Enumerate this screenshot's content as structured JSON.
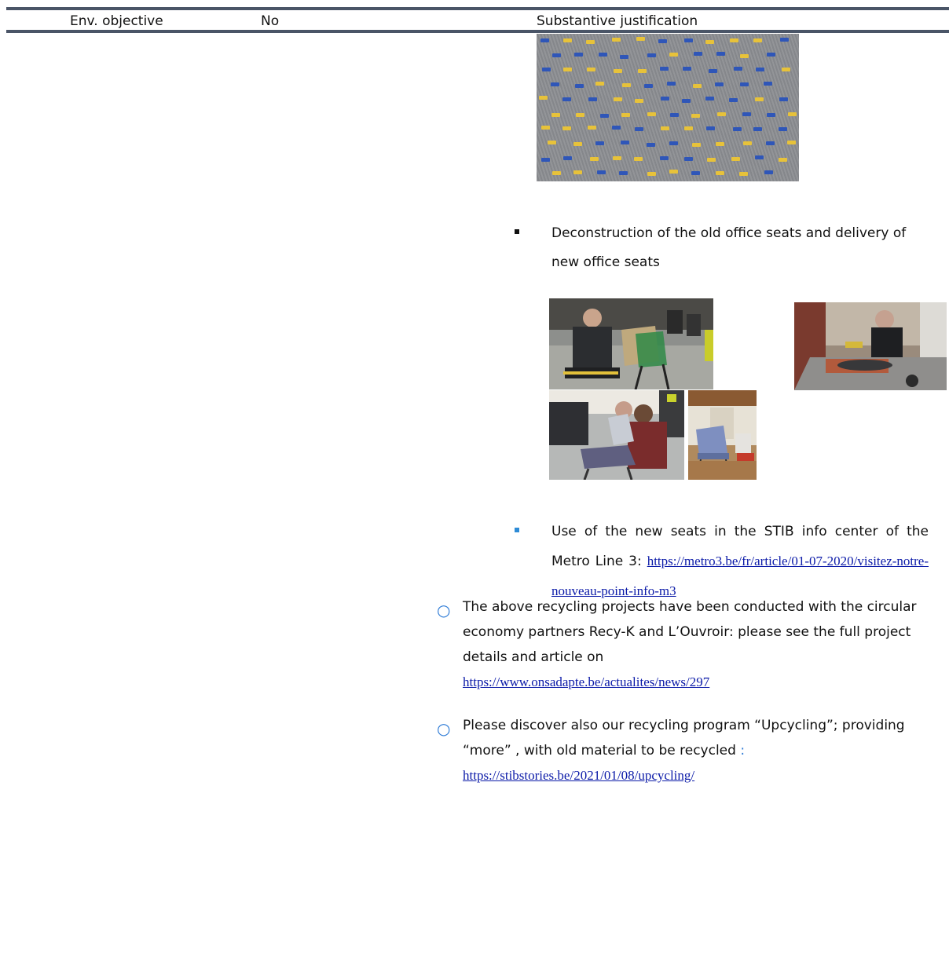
{
  "table_header": {
    "col1": "Env. objective",
    "col2": "No",
    "col3": "Substantive justification"
  },
  "items": {
    "deconstruction": "Deconstruction of the old office seats and delivery of new office seats",
    "use_prefix": "Use of the new seats in the STIB info center of the Metro Line 3:",
    "use_link": "https://metro3.be/fr/article/01-07-2020/visitez-notre-nouveau-point-info-m3",
    "recycling_text": "The above recycling projects have been conducted with the circular economy partners Recy-K and L’Ouvroir: please see the full project details and article on",
    "recycling_link": "https://www.onsadapte.be/actualites/news/297",
    "upcycling_text": "Please discover also our recycling program “Upcycling”; providing “more” , with old material to be recycled",
    "upcycling_colon": ":",
    "upcycling_link": "https://stibstories.be/2021/01/08/upcycling/"
  },
  "colors": {
    "rule": "#4a5567",
    "link": "#0b1aa8",
    "accent": "#2e7bd6",
    "fabric_yellow": "#e7c23a",
    "fabric_blue": "#2f56b8"
  },
  "images": [
    "fabric-sample-photo",
    "worker-assembling-chair-photo",
    "worker-at-workbench-photo",
    "two-workers-seat-photo",
    "info-center-seats-photo"
  ]
}
